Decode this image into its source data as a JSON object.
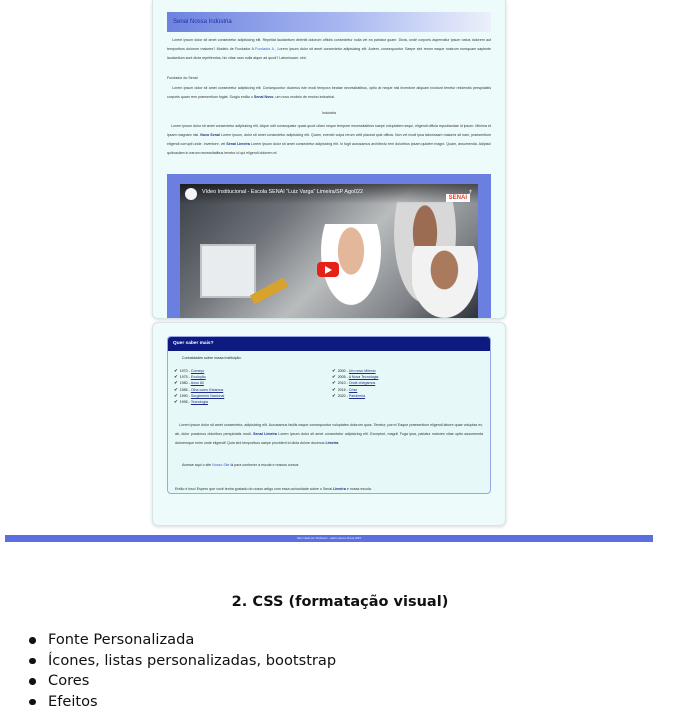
{
  "embedded_page": {
    "header_label": "Senai Nossa Indústria",
    "para1": "Lorem ipsum dolor sit amet consectetur adipisicing elit. Repellat laudantium deleniti dolorum officiis consectetur nulla vel ea pariatur quam. Dicta, unde corporis aspernatur ipsum natus dolorem aut temporibus dolorum maiores? Modelo de Fundador A",
    "para1_link": "Fundador A",
    "para1_tail": ", Lorem ipsum dolor sit amet consectetur adipisicing elit. Autem, consequuntur. Saepe sint rerum eaque nostrum numquam sapiente laudantium sunt dicta repellendus, hic vitae nam nulla atque ad quod? Laboriosam, sint.",
    "fundador_label": "Fundador do Senai",
    "para2": "Lorem ipsum dolor sit amet consectetur adipisicing elit. Consequuntur ducimus iste modi tempora beatae necessitatibus, optio at neque nisi inventore aliquam incidunt tenetur reiciendis perspiciatis corporis quam rem praesentium fugiat. Surgiu então o",
    "para2_bold": "Senai Novo",
    "para2_tail": ", um novo modelo de ensino industrial.",
    "industria_label": "Indústria",
    "para3": "Lorem ipsum dolor sit amet consectetur adipisicing elit. Atque odit consequatur quasi quod ullam neque tempore necessitatibus saepe voluptatem sequi, eligendi officia repudiandae id ipsum. Minima et ipsam magnam nisi.",
    "para3_bold1": "Novo Senai",
    "para3_mid": "Lorem ipsum, dolor sit amet consectetur adipisicing elit. Quam, eveniet culpa rerum velit placeat quis officia. Non vel modi ipsa laboriosam maiores sit nam, praesentium eligendi corrupti unde. Inventore, vel",
    "para3_bold2": "Senai Limeira",
    "para3_tail": "Lorem ipsum dolor sit amet consectetur adipisicing elit. In fugit accusamus architecto rem doloribus ipsam quidem magni. Quam, assumenda. Adipisci quibusdam in earum necessitatibus tenetur id qui eligendi dolorem et.",
    "video_title": "Vídeo Institucional - Escola SENAI \"Luiz Varga\" Limeira/SP Ago022",
    "video_share": "⤴",
    "video_logo": "SENAI"
  },
  "info_box": {
    "title": "Quer saber mais?",
    "intro": "Curiosidades sobre nossa instituição:",
    "left_items": [
      {
        "year": "1970 - ",
        "label": "Começo"
      },
      {
        "year": "1975 - ",
        "label": "Evolução"
      },
      {
        "year": "1980 - ",
        "label": "Anos 80"
      },
      {
        "year": "1985 - ",
        "label": "Olha como Estamos"
      },
      {
        "year": "1990 - ",
        "label": "Surgimento Nacional"
      },
      {
        "year": "1995 - ",
        "label": "Tecnologia"
      }
    ],
    "right_items": [
      {
        "year": "2000 - ",
        "label": "Um novo Milenio"
      },
      {
        "year": "2005 - ",
        "label": "A Nova Tecnologia"
      },
      {
        "year": "2010 - ",
        "label": "Onde chegamos"
      },
      {
        "year": "2015 - ",
        "label": "Crise"
      },
      {
        "year": "2020 - ",
        "label": "Pandemia"
      }
    ],
    "para": "Lorem ipsum dolor sit amet consectetur, adipisicing elit. Accusamus facilis eaque consequuntur voluptates dolorum quos. Tenetur, porro! Eaque praesentium eligendi labore quae voluptas ex, ab, dolor possimus doloribus perspiciatis modi.",
    "para_bold": "Senai Limeira",
    "para_tail": "Lorem ipsum dolor sit amet consectetur adipisicing elit. Excepturi, magni! Fuga ipsa, pariatur maiores vitae optio assumenda doloremque enim unde eligendi! Quia sint temporibus saepe provident id dicta dolore ducimus",
    "para_bold2": "Limeira",
    "access_pre": "Acesse aqui o site",
    "access_link": "Nosso Site",
    "access_post": "para conhecer a escola e nossos cursos",
    "closing_pre": "Então é isso! Espero que você tenha gostado do nosso artigo com essa curiosidade sobre o Senai",
    "closing_bold": "Limeira",
    "closing_post": "e nossa escola."
  },
  "footer_strip": "Site criado por Professor - Apoio para a Prova 2022",
  "heading": "2. CSS (formatação visual)",
  "bullets": [
    "Fonte Personalizada",
    "Ícones, listas personalizadas, bootstrap",
    "Cores",
    "Efeitos"
  ]
}
